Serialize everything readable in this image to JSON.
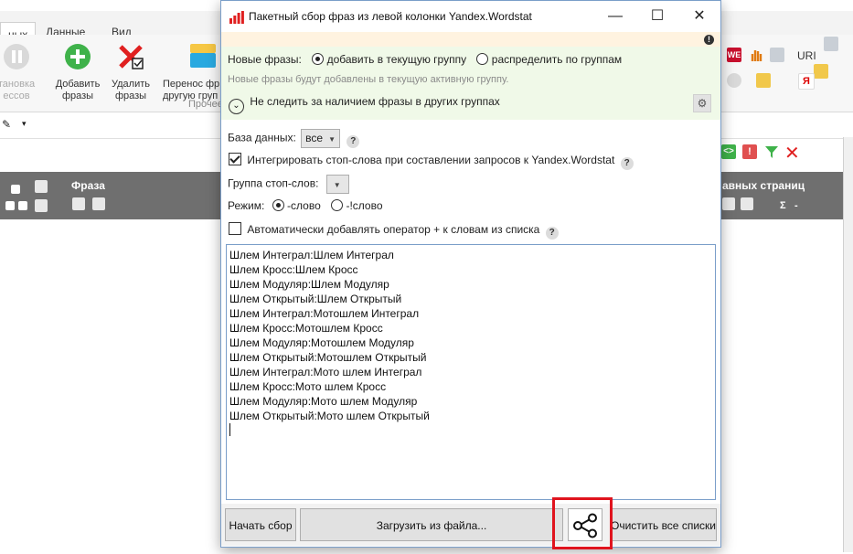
{
  "background_app": {
    "title_fragment": "",
    "tabs": [
      "ных",
      "Данные",
      "Вид"
    ],
    "ribbon": {
      "stop_label_line1": "тановка",
      "stop_label_line2": "ессов",
      "add_phrases_line1": "Добавить",
      "add_phrases_line2": "фразы",
      "delete_phrases_line1": "Удалить",
      "delete_phrases_line2": "фразы",
      "move_line1": "Перенос фр",
      "move_line2": "другую груп",
      "group_label": "Прочее",
      "url_label": "URI"
    },
    "grid": {
      "phrase_header": "Фраза",
      "main_pages_header": "авных страниц",
      "sigma": "Σ",
      "dash": "-"
    }
  },
  "dialog": {
    "title": "Пакетный сбор фраз из левой колонки Yandex.Wordstat",
    "help_symbol": "!",
    "new_phrases": {
      "label": "Новые фразы:",
      "option_add": "добавить в текущую группу",
      "option_distribute": "распределить по группам",
      "hint": "Новые фразы будут добавлены в текущую активную группу."
    },
    "track_others_label": "Не следить за наличием фразы в других группах",
    "database": {
      "label": "База данных:",
      "value": "все"
    },
    "integrate_stopwords_label": "Интегрировать стоп-слова при составлении запросов к Yandex.Wordstat",
    "stopword_group_label": "Группа стоп-слов:",
    "mode": {
      "label": "Режим:",
      "option_minus": "-слово",
      "option_minus_excl": "-!слово"
    },
    "auto_plus_label": "Автоматически добавлять оператор + к словам из списка",
    "phrases": [
      "Шлем Интеграл:Шлем Интеграл",
      "Шлем Кросс:Шлем Кросс",
      "Шлем Модуляр:Шлем Модуляр",
      "Шлем Открытый:Шлем Открытый",
      "Шлем Интеграл:Мотошлем Интеграл",
      "Шлем Кросс:Мотошлем Кросс",
      "Шлем Модуляр:Мотошлем Модуляр",
      "Шлем Открытый:Мотошлем Открытый",
      "Шлем Интеграл:Мото шлем Интеграл",
      "Шлем Кросс:Мото шлем Кросс",
      "Шлем Модуляр:Мото шлем Модуляр",
      "Шлем Открытый:Мото шлем Открытый"
    ],
    "buttons": {
      "start": "Начать сбор",
      "load_file": "Загрузить из файла...",
      "clear_all": "Очистить все списки"
    }
  },
  "colors": {
    "accent_red": "#e0141e",
    "green_panel": "#f0f9e8",
    "help_bar": "#fff3e0",
    "grid_header": "#6f6f6f"
  },
  "icons": [
    "stop-icon",
    "add-icon",
    "delete-icon",
    "move-icon",
    "share-icon",
    "gear-icon",
    "chevron-down-icon",
    "help-icon",
    "wordstat-bars-icon"
  ]
}
